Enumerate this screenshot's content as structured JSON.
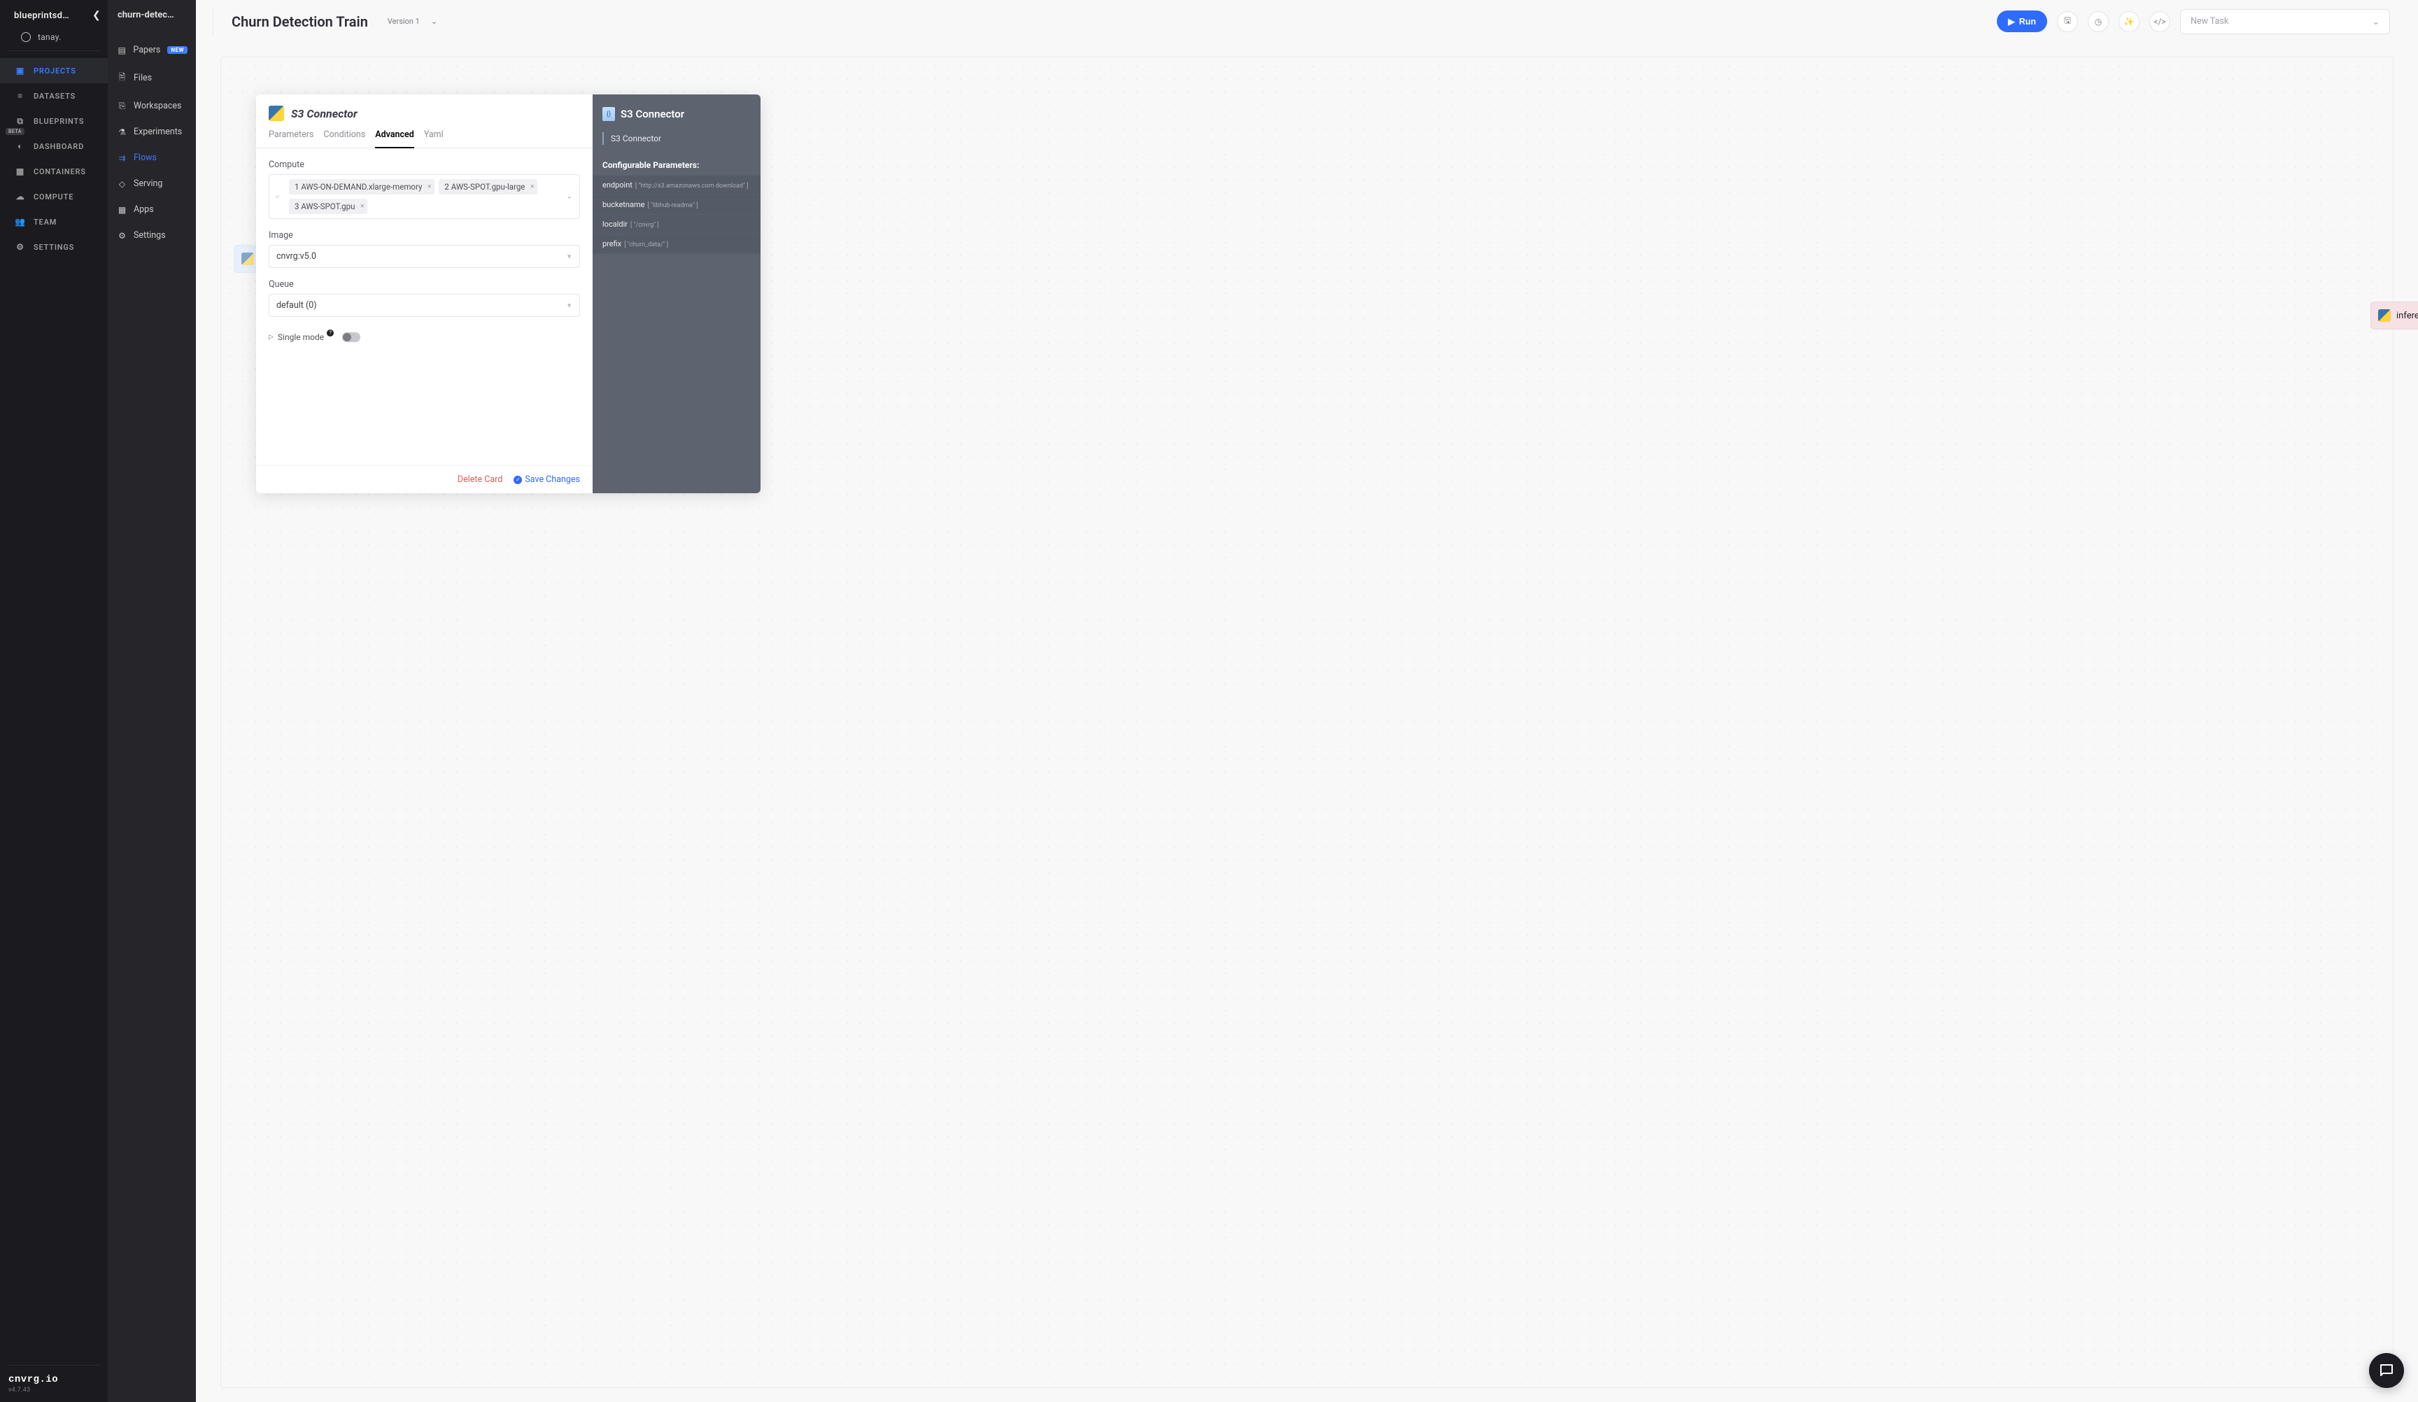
{
  "sb1": {
    "org_name": "blueprintsd…",
    "user_name": "tanay.",
    "items": [
      {
        "label": "PROJECTS",
        "active": true
      },
      {
        "label": "DATASETS"
      },
      {
        "label": "BLUEPRINTS",
        "beta": true
      },
      {
        "label": "DASHBOARD"
      },
      {
        "label": "CONTAINERS"
      },
      {
        "label": "COMPUTE"
      },
      {
        "label": "TEAM"
      },
      {
        "label": "SETTINGS"
      }
    ],
    "brand": "cnvrg.io",
    "version": "v4.7.43"
  },
  "sb2": {
    "project_name": "churn-detec…",
    "items": [
      {
        "label": "Papers",
        "badge": "NEW"
      },
      {
        "label": "Files"
      },
      {
        "label": "Workspaces"
      },
      {
        "label": "Experiments"
      },
      {
        "label": "Flows",
        "active": true
      },
      {
        "label": "Serving"
      },
      {
        "label": "Apps"
      },
      {
        "label": "Settings"
      }
    ]
  },
  "topbar": {
    "title": "Churn Detection Train",
    "version": "Version 1",
    "run": "Run",
    "newtask_placeholder": "New Task"
  },
  "canvas_nodes": {
    "inference": "inference"
  },
  "modal": {
    "title": "S3 Connector",
    "tabs": [
      "Parameters",
      "Conditions",
      "Advanced",
      "Yaml"
    ],
    "active_tab": "Advanced",
    "compute_label": "Compute",
    "compute_chips": [
      "1 AWS-ON-DEMAND.xlarge-memory",
      "2 AWS-SPOT.gpu-large",
      "3 AWS-SPOT.gpu"
    ],
    "image_label": "Image",
    "image_value": "cnvrg:v5.0",
    "queue_label": "Queue",
    "queue_value": "default (0)",
    "single_mode_label": "Single mode",
    "delete_label": "Delete Card",
    "save_label": "Save Changes"
  },
  "info_panel": {
    "title": "S3 Connector",
    "subtitle": "S3 Connector",
    "params_title": "Configurable Parameters:",
    "params": [
      {
        "name": "endpoint",
        "value": "[ \"http://s3.amazonaws.com download\" ]"
      },
      {
        "name": "bucketname",
        "value": "[ \"libhub-readme\" ]"
      },
      {
        "name": "localdir",
        "value": "[ \"/cnvrg\" ]"
      },
      {
        "name": "prefix",
        "value": "[ \"churn_data/\" ]"
      }
    ]
  }
}
